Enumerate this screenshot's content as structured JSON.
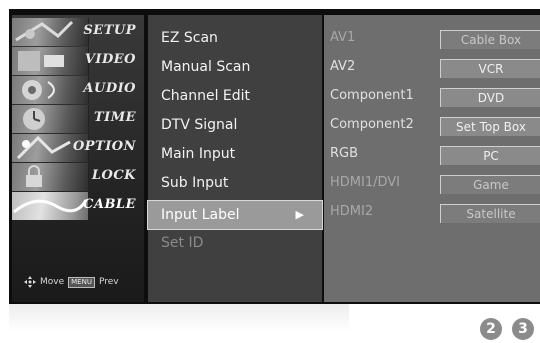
{
  "categories": [
    {
      "label": "SETUP",
      "icon": "setup-icon"
    },
    {
      "label": "VIDEO",
      "icon": "video-icon"
    },
    {
      "label": "AUDIO",
      "icon": "audio-icon"
    },
    {
      "label": "TIME",
      "icon": "time-icon"
    },
    {
      "label": "OPTION",
      "icon": "option-icon"
    },
    {
      "label": "LOCK",
      "icon": "lock-icon"
    },
    {
      "label": "CABLE",
      "icon": "cable-icon"
    }
  ],
  "footer": {
    "move_label": "Move",
    "menu_key": "MENU",
    "prev_label": "Prev"
  },
  "submenu": [
    {
      "label": "EZ Scan"
    },
    {
      "label": "Manual Scan"
    },
    {
      "label": "Channel Edit"
    },
    {
      "label": "DTV Signal"
    },
    {
      "label": "Main Input"
    },
    {
      "label": "Sub Input"
    },
    {
      "label": "Input Label",
      "selected": true
    },
    {
      "label": "Set ID",
      "disabled": true
    }
  ],
  "arrow": "▶",
  "input_labels": [
    {
      "source": "AV1",
      "label": "Cable Box"
    },
    {
      "source": "AV2",
      "label": "VCR"
    },
    {
      "source": "Component1",
      "label": "DVD"
    },
    {
      "source": "Component2",
      "label": "Set Top Box"
    },
    {
      "source": "RGB",
      "label": "PC"
    },
    {
      "source": "HDMI1/DVI",
      "label": "Game"
    },
    {
      "source": "HDMI2",
      "label": "Satellite"
    }
  ],
  "badges": [
    "2",
    "3"
  ]
}
